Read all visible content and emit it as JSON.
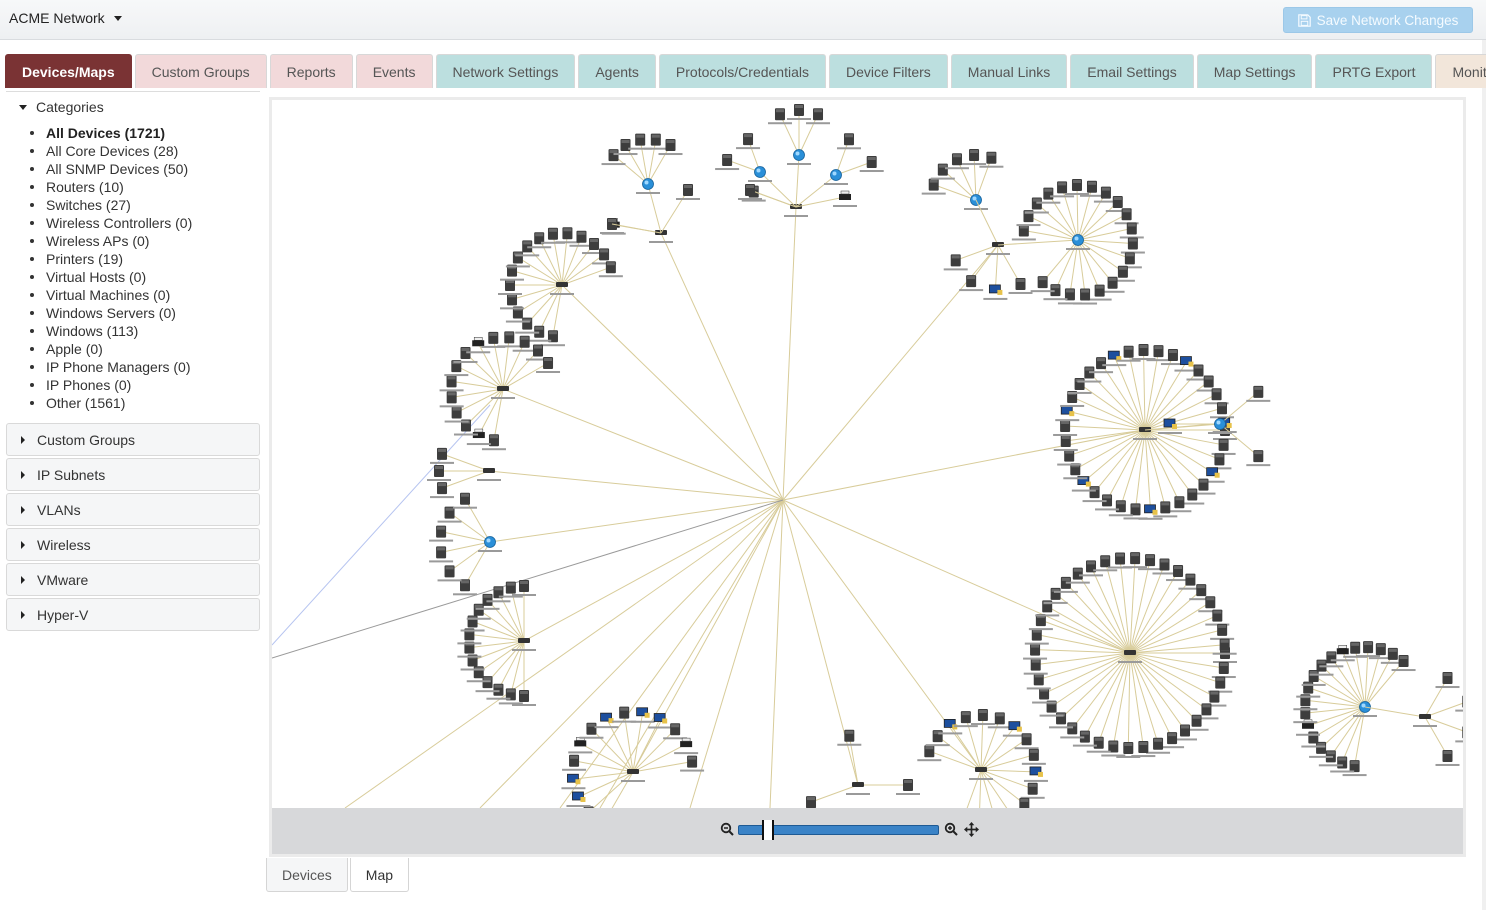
{
  "header": {
    "network_name": "ACME Network",
    "save_button": "Save Network Changes"
  },
  "tabs": [
    {
      "label": "Devices/Maps",
      "style": "active"
    },
    {
      "label": "Custom Groups",
      "style": "pink"
    },
    {
      "label": "Reports",
      "style": "pink"
    },
    {
      "label": "Events",
      "style": "pink"
    },
    {
      "label": "Network Settings",
      "style": "teal"
    },
    {
      "label": "Agents",
      "style": "teal"
    },
    {
      "label": "Protocols/Credentials",
      "style": "teal"
    },
    {
      "label": "Device Filters",
      "style": "teal"
    },
    {
      "label": "Manual Links",
      "style": "teal"
    },
    {
      "label": "Email Settings",
      "style": "teal"
    },
    {
      "label": "Map Settings",
      "style": "teal"
    },
    {
      "label": "PRTG Export",
      "style": "teal"
    },
    {
      "label": "Monitors",
      "style": "beige"
    }
  ],
  "sidebar": {
    "categories_header": "Categories",
    "categories": [
      {
        "label": "All Devices (1721)",
        "selected": true
      },
      {
        "label": "All Core Devices (28)"
      },
      {
        "label": "All SNMP Devices (50)"
      },
      {
        "label": "Routers (10)"
      },
      {
        "label": "Switches (27)"
      },
      {
        "label": "Wireless Controllers (0)"
      },
      {
        "label": "Wireless APs (0)"
      },
      {
        "label": "Printers (19)"
      },
      {
        "label": "Virtual Hosts (0)"
      },
      {
        "label": "Virtual Machines (0)"
      },
      {
        "label": "Windows Servers (0)"
      },
      {
        "label": "Windows (113)"
      },
      {
        "label": "Apple (0)"
      },
      {
        "label": "IP Phone Managers (0)"
      },
      {
        "label": "IP Phones (0)"
      },
      {
        "label": "Other (1561)"
      }
    ],
    "panels": [
      {
        "label": "Custom Groups"
      },
      {
        "label": "IP Subnets"
      },
      {
        "label": "VLANs"
      },
      {
        "label": "Wireless"
      },
      {
        "label": "VMware"
      },
      {
        "label": "Hyper-V"
      }
    ]
  },
  "map": {
    "zoom_level": 0.12,
    "link_color": "#d8cc9a",
    "colors": {
      "accent": "#7a3334",
      "slider": "#3a83c7"
    }
  },
  "bottom_tabs": [
    {
      "label": "Devices",
      "active": false
    },
    {
      "label": "Map",
      "active": true
    }
  ]
}
